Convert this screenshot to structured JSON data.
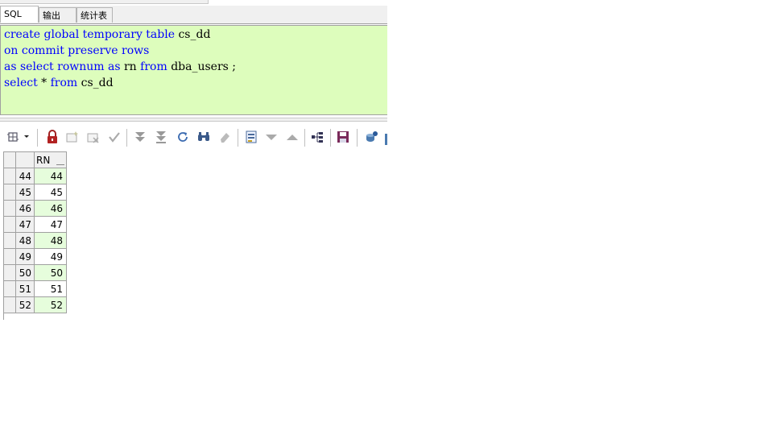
{
  "tabs": [
    {
      "label": "SQL",
      "active": true
    },
    {
      "label": "输出",
      "active": false
    },
    {
      "label": "统计表",
      "active": false
    }
  ],
  "editor": {
    "background": "#ddfdbc",
    "keyword_color": "#0000ff",
    "lines": [
      [
        {
          "t": "create global temporary table ",
          "k": true
        },
        {
          "t": "cs_dd",
          "k": false
        }
      ],
      [
        {
          "t": "on commit preserve rows",
          "k": true
        }
      ],
      [
        {
          "t": "as select rownum as ",
          "k": true
        },
        {
          "t": "rn ",
          "k": false
        },
        {
          "t": "from ",
          "k": true
        },
        {
          "t": "dba_users ;",
          "k": false
        }
      ],
      [
        {
          "t": "select ",
          "k": true
        },
        {
          "t": "* ",
          "k": false
        },
        {
          "t": "from ",
          "k": true
        },
        {
          "t": "cs_dd",
          "k": false
        }
      ]
    ]
  },
  "toolbar": {
    "icons": [
      "grid-menu-icon",
      "lock-icon",
      "add-record-icon",
      "delete-record-icon",
      "post-changes-icon",
      "next-page-icon",
      "last-page-icon",
      "refresh-icon",
      "find-icon",
      "clear-icon",
      "single-record-view-icon",
      "sort-descending-icon",
      "sort-ascending-icon",
      "query-by-example-icon",
      "save-icon",
      "export-icon"
    ]
  },
  "result_grid": {
    "column_header": "RN",
    "rows": [
      {
        "num": "44",
        "rn": "44"
      },
      {
        "num": "45",
        "rn": "45"
      },
      {
        "num": "46",
        "rn": "46"
      },
      {
        "num": "47",
        "rn": "47"
      },
      {
        "num": "48",
        "rn": "48"
      },
      {
        "num": "49",
        "rn": "49"
      },
      {
        "num": "50",
        "rn": "50"
      },
      {
        "num": "51",
        "rn": "51"
      },
      {
        "num": "52",
        "rn": "52"
      }
    ]
  }
}
